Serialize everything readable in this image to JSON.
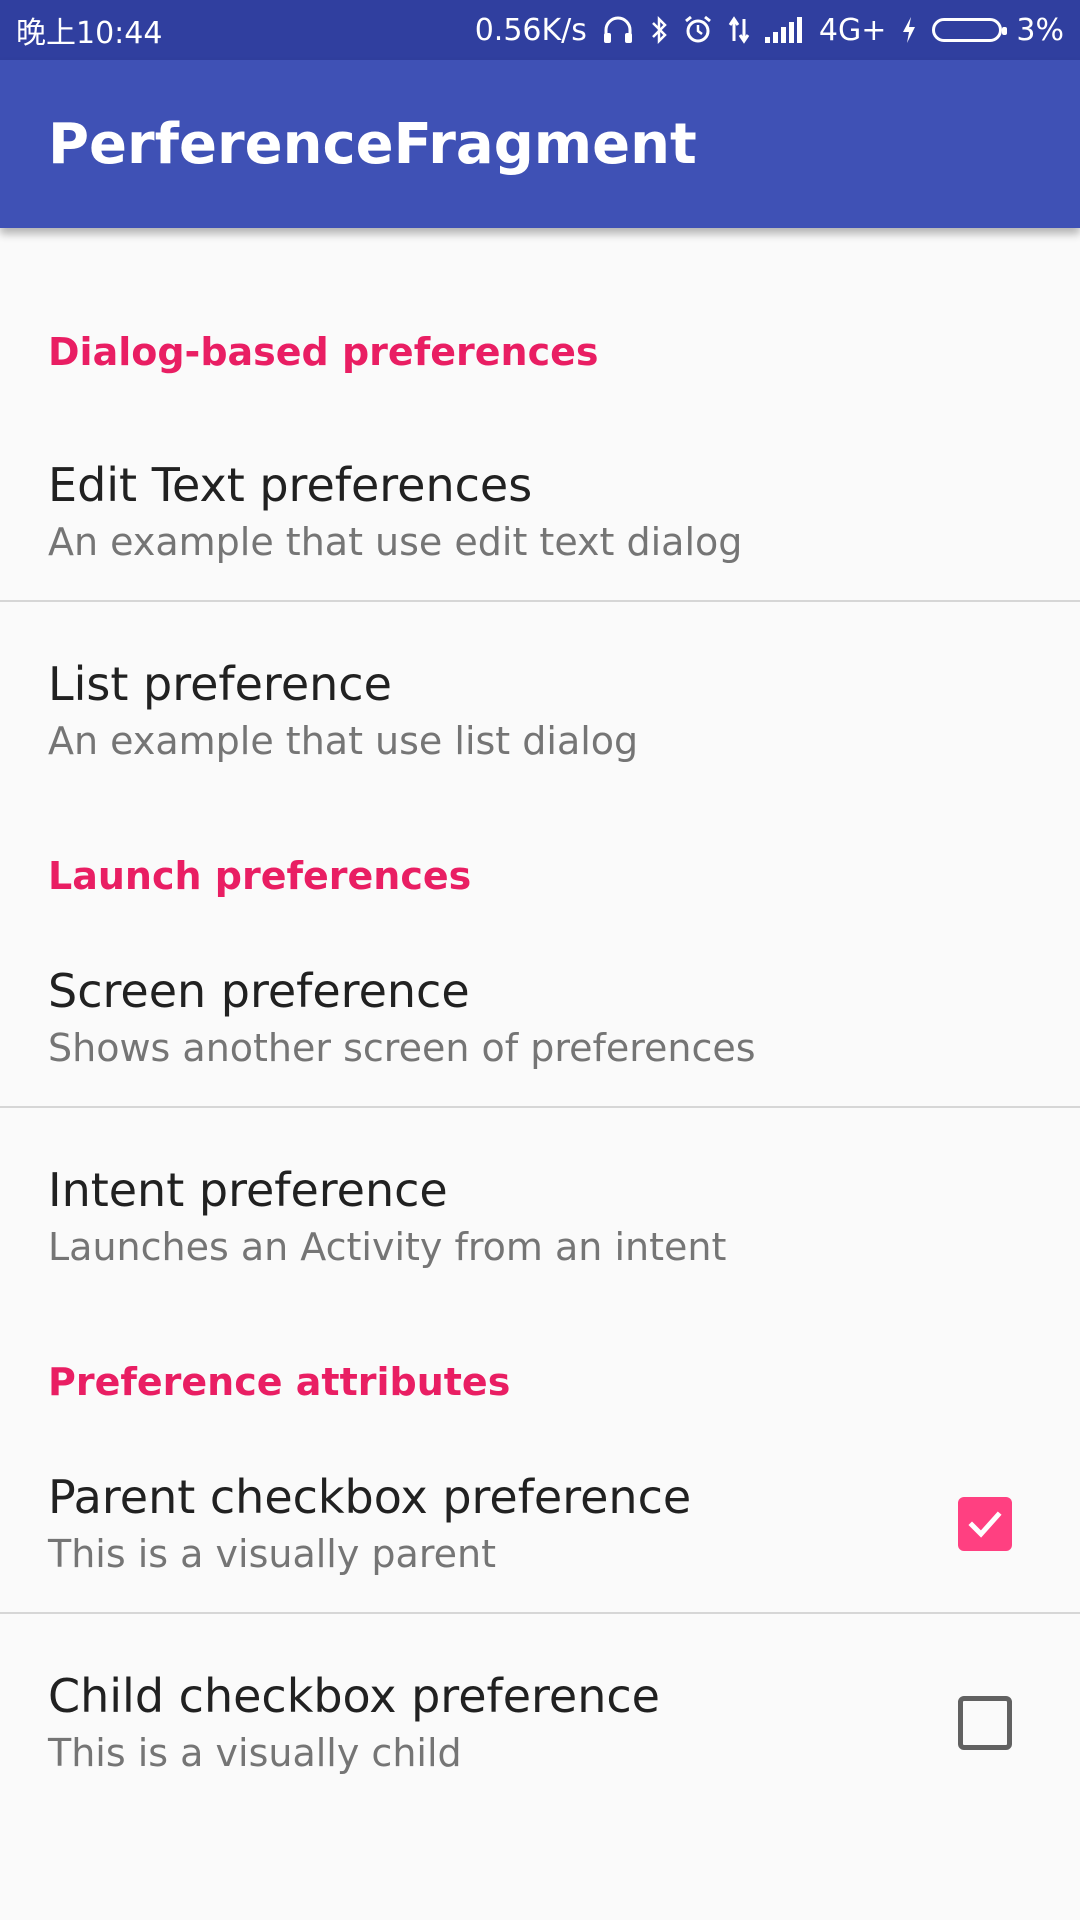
{
  "status_bar": {
    "time": "晚上10:44",
    "net_speed": "0.56K/s",
    "network_type": "4G+",
    "battery": "3%",
    "icons": [
      "headphones-icon",
      "bluetooth-icon",
      "alarm-icon",
      "data-arrows-icon",
      "signal-icon",
      "charging-icon",
      "battery-icon"
    ]
  },
  "app_bar": {
    "title": "PerferenceFragment"
  },
  "sections": [
    {
      "category": "Dialog-based preferences",
      "items": [
        {
          "title": "Edit Text preferences",
          "summary": "An example that use edit text dialog"
        },
        {
          "title": "List preference",
          "summary": "An example that use list dialog"
        }
      ]
    },
    {
      "category": "Launch preferences",
      "items": [
        {
          "title": "Screen preference",
          "summary": "Shows another screen of preferences"
        },
        {
          "title": "Intent preference",
          "summary": "Launches an Activity from an intent"
        }
      ]
    },
    {
      "category": "Preference attributes",
      "items": [
        {
          "title": "Parent checkbox preference",
          "summary": "This is a visually parent",
          "checked": true
        },
        {
          "title": "Child checkbox preference",
          "summary": "This is a visually child",
          "checked": false
        }
      ]
    }
  ],
  "colors": {
    "primary": "#3F51B5",
    "primary_dark": "#303F9F",
    "accent": "#FF4081",
    "category_text": "#E91E63"
  }
}
